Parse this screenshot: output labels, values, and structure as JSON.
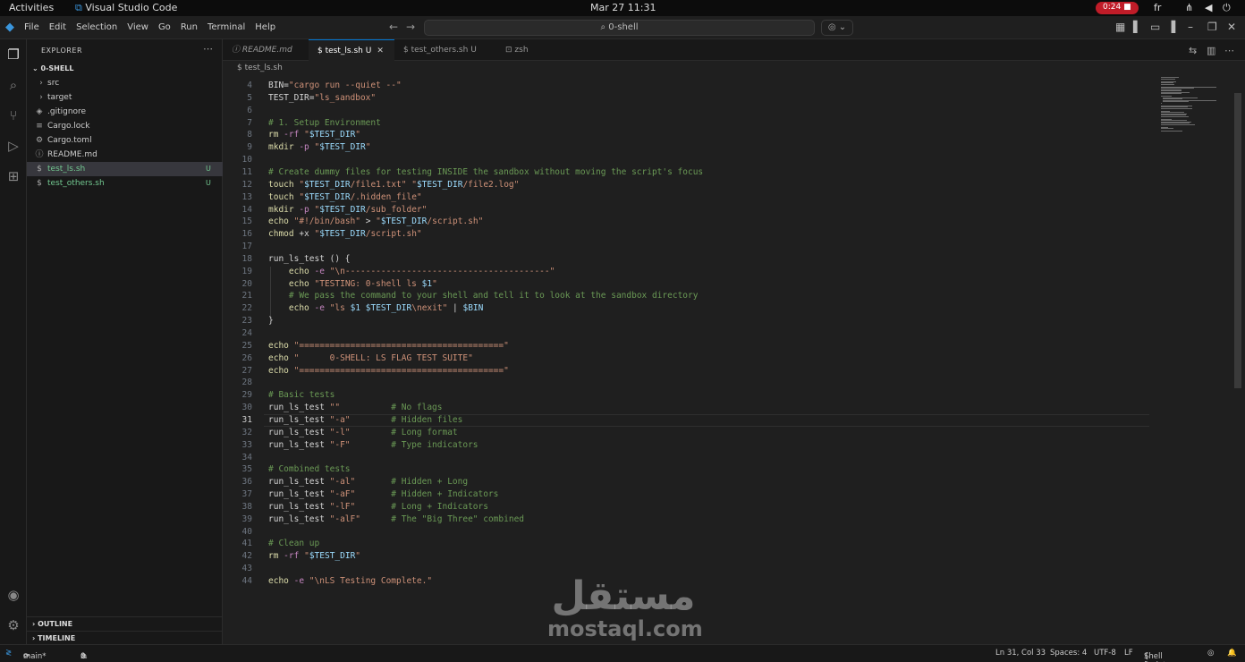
{
  "system": {
    "activities": "Activities",
    "app_name": "Visual Studio Code",
    "clock": "Mar 27  11:31",
    "recording": "0:24",
    "language": "fr"
  },
  "titlebar": {
    "menu": [
      "File",
      "Edit",
      "Selection",
      "View",
      "Go",
      "Run",
      "Terminal",
      "Help"
    ],
    "command_center": "0-shell"
  },
  "sidebar": {
    "title": "EXPLORER",
    "root": "0-SHELL",
    "items": [
      {
        "label": "src",
        "icon": "chevron-right-icon",
        "badge": ""
      },
      {
        "label": "target",
        "icon": "chevron-right-icon",
        "badge": ""
      },
      {
        "label": ".gitignore",
        "icon": "gitignore-icon",
        "badge": ""
      },
      {
        "label": "Cargo.lock",
        "icon": "lock-file-icon",
        "badge": ""
      },
      {
        "label": "Cargo.toml",
        "icon": "gear-icon",
        "badge": ""
      },
      {
        "label": "README.md",
        "icon": "info-icon",
        "badge": ""
      },
      {
        "label": "test_ls.sh",
        "icon": "shell-file-icon",
        "badge": "U"
      },
      {
        "label": "test_others.sh",
        "icon": "shell-file-icon",
        "badge": "U"
      }
    ],
    "outline": "OUTLINE",
    "timeline": "TIMELINE"
  },
  "tabs": [
    {
      "label": "README.md",
      "icon": "info-icon",
      "status": ""
    },
    {
      "label": "test_ls.sh",
      "icon": "shell-file-icon",
      "status": "U"
    },
    {
      "label": "test_others.sh",
      "icon": "shell-file-icon",
      "status": "U"
    },
    {
      "label": "zsh",
      "icon": "terminal-icon",
      "status": ""
    }
  ],
  "breadcrumb": "$ test_ls.sh",
  "editor": {
    "current_line": 31,
    "lines": [
      {
        "n": 4,
        "text": "BIN=\"cargo run --quiet --\""
      },
      {
        "n": 5,
        "text": "TEST_DIR=\"ls_sandbox\""
      },
      {
        "n": 6,
        "text": ""
      },
      {
        "n": 7,
        "text": "# 1. Setup Environment"
      },
      {
        "n": 8,
        "text": "rm -rf \"$TEST_DIR\""
      },
      {
        "n": 9,
        "text": "mkdir -p \"$TEST_DIR\""
      },
      {
        "n": 10,
        "text": ""
      },
      {
        "n": 11,
        "text": "# Create dummy files for testing INSIDE the sandbox without moving the script's focus"
      },
      {
        "n": 12,
        "text": "touch \"$TEST_DIR/file1.txt\" \"$TEST_DIR/file2.log\""
      },
      {
        "n": 13,
        "text": "touch \"$TEST_DIR/.hidden_file\""
      },
      {
        "n": 14,
        "text": "mkdir -p \"$TEST_DIR/sub_folder\""
      },
      {
        "n": 15,
        "text": "echo \"#!/bin/bash\" > \"$TEST_DIR/script.sh\""
      },
      {
        "n": 16,
        "text": "chmod +x \"$TEST_DIR/script.sh\""
      },
      {
        "n": 17,
        "text": ""
      },
      {
        "n": 18,
        "text": "run_ls_test () {"
      },
      {
        "n": 19,
        "text": "    echo -e \"\\n----------------------------------------\""
      },
      {
        "n": 20,
        "text": "    echo \"TESTING: 0-shell ls $1\""
      },
      {
        "n": 21,
        "text": "    # We pass the command to your shell and tell it to look at the sandbox directory"
      },
      {
        "n": 22,
        "text": "    echo -e \"ls $1 $TEST_DIR\\nexit\" | $BIN"
      },
      {
        "n": 23,
        "text": "}"
      },
      {
        "n": 24,
        "text": ""
      },
      {
        "n": 25,
        "text": "echo \"========================================\""
      },
      {
        "n": 26,
        "text": "echo \"      0-SHELL: LS FLAG TEST SUITE\""
      },
      {
        "n": 27,
        "text": "echo \"========================================\""
      },
      {
        "n": 28,
        "text": ""
      },
      {
        "n": 29,
        "text": "# Basic tests"
      },
      {
        "n": 30,
        "text": "run_ls_test \"\"          # No flags"
      },
      {
        "n": 31,
        "text": "run_ls_test \"-a\"        # Hidden files"
      },
      {
        "n": 32,
        "text": "run_ls_test \"-l\"        # Long format"
      },
      {
        "n": 33,
        "text": "run_ls_test \"-F\"        # Type indicators"
      },
      {
        "n": 34,
        "text": ""
      },
      {
        "n": 35,
        "text": "# Combined tests"
      },
      {
        "n": 36,
        "text": "run_ls_test \"-al\"       # Hidden + Long"
      },
      {
        "n": 37,
        "text": "run_ls_test \"-aF\"       # Hidden + Indicators"
      },
      {
        "n": 38,
        "text": "run_ls_test \"-lF\"       # Long + Indicators"
      },
      {
        "n": 39,
        "text": "run_ls_test \"-alF\"      # The \"Big Three\" combined"
      },
      {
        "n": 40,
        "text": ""
      },
      {
        "n": 41,
        "text": "# Clean up"
      },
      {
        "n": 42,
        "text": "rm -rf \"$TEST_DIR\""
      },
      {
        "n": 43,
        "text": ""
      },
      {
        "n": 44,
        "text": "echo -e \"\\nLS Testing Complete.\""
      }
    ]
  },
  "watermark": {
    "arabic": "مستقل",
    "latin": "mostaql.com"
  },
  "statusbar": {
    "branch": "main*",
    "errors": "0",
    "warnings": "0",
    "position": "Ln 31, Col 33",
    "spaces": "Spaces: 4",
    "encoding": "UTF-8",
    "eol": "LF",
    "language": "Shell Script"
  },
  "colors": {
    "keyword": "#c586c0",
    "string": "#ce9178",
    "comment": "#6a9955",
    "variable": "#9cdcfe",
    "accent": "#0078d4",
    "untracked": "#73c991"
  }
}
